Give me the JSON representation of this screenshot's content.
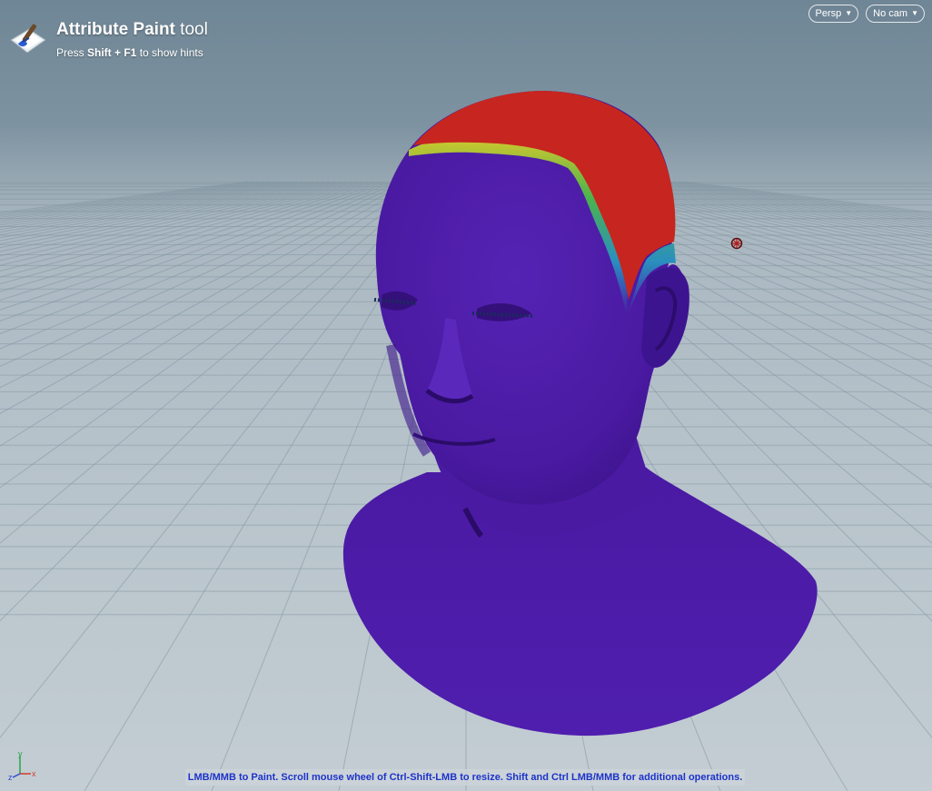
{
  "tool": {
    "title_strong": "Attribute Paint",
    "title_rest": " tool",
    "hint_prefix": "Press ",
    "hint_keys": "Shift + F1",
    "hint_suffix": " to show hints",
    "icon": "paint-brush-icon"
  },
  "view_menu": {
    "projection": {
      "label": "Persp",
      "icon": "chevron-down-icon"
    },
    "camera": {
      "label": "No cam",
      "icon": "chevron-down-icon"
    }
  },
  "axis_gizmo": {
    "x": "x",
    "y": "y",
    "z": "z"
  },
  "status": {
    "message": "LMB/MMB to Paint.  Scroll mouse wheel of Ctrl-Shift-LMB to resize.  Shift and Ctrl LMB/MMB for additional operations."
  },
  "colors": {
    "mesh_base": "#4c1ba6",
    "paint_high": "#c6261f",
    "gradient_mid_yellow": "#d6c92c",
    "gradient_mid_green": "#3fae4a",
    "gradient_mid_cyan": "#2a8fbf",
    "status_text": "#1d33c9"
  }
}
